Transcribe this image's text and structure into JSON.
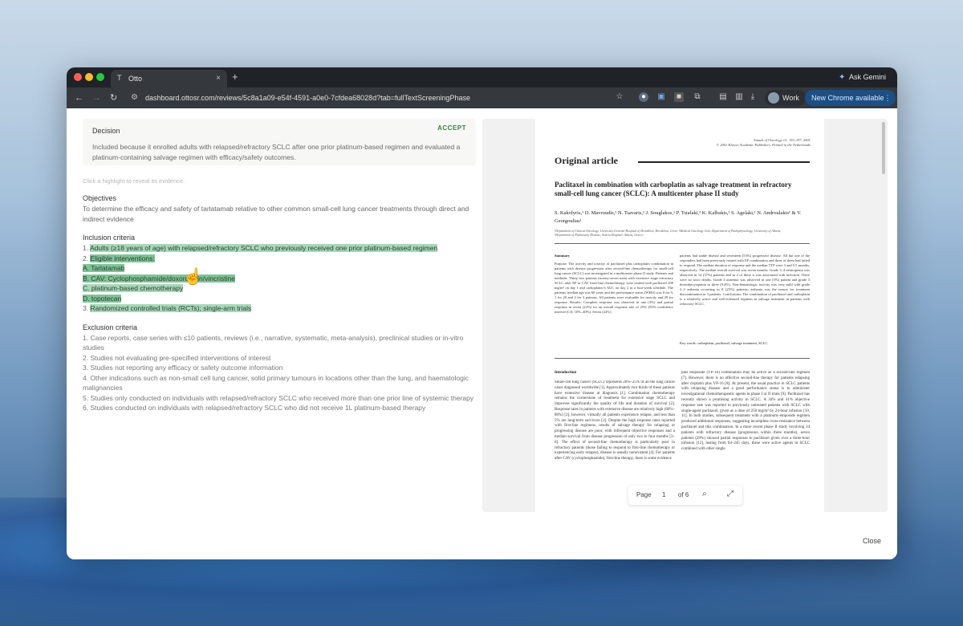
{
  "browser": {
    "tab_title": "Otto",
    "tab_favicon": "T",
    "tab_close": "×",
    "new_tab": "+",
    "ask_gemini": "Ask Gemini",
    "url": "dashboard.ottosr.com/reviews/5c8a1a09-e54f-4591-a0e0-7cfdea68028d?tab=fullTextScreeningPhase",
    "profile_label": "Work",
    "update_label": "New Chrome available"
  },
  "decision": {
    "title": "Decision",
    "status": "ACCEPT",
    "status_color": "#3b7d47",
    "text": "Included because it enrolled adults with relapsed/refractory SCLC after one prior platinum-based regimen and evaluated a platinum-containing salvage regimen with efficacy/safety outcomes."
  },
  "hint": "Click a highlight to reveal its evidence.",
  "objectives": {
    "title": "Objectives",
    "text": "To determine the efficacy and safety of tarlatamab relative to other common small-cell lung cancer treatments through direct and indirect evidence"
  },
  "inclusion": {
    "title": "Inclusion criteria",
    "items": [
      {
        "prefix": "1. ",
        "text": "Adults (≥18 years of age) with relapsed/refractory SCLC who previously received one prior platinum-based regimen"
      },
      {
        "prefix": "2. ",
        "text": "Eligible interventions:"
      },
      {
        "prefix": "",
        "text": "A. Tarlatamab"
      },
      {
        "prefix": "",
        "text": "B. CAV: Cyclophosphamide/doxorubicin/vincristine"
      },
      {
        "prefix": "",
        "text": "C. platinum-based chemotherapy"
      },
      {
        "prefix": "",
        "text": "D. topotecan"
      },
      {
        "prefix": "3. ",
        "text": "Randomized controlled trials (RCTs); single-arm trials"
      }
    ]
  },
  "exclusion": {
    "title": "Exclusion criteria",
    "items": [
      "1. Case reports, case series with ≤10 patients, reviews (i.e., narrative, systematic, meta-analysis), preclinical studies or in-vitro studies",
      "2. Studies not evaluating pre-specified interventions of interest",
      "3. Studies not reporting any efficacy or safety outcome information",
      "4.  Other indications such as non-small cell lung cancer, solid primary tumours in locations other than the lung, and haematologic malignancies",
      "5. Studies only conducted on individuals with relapsed/refractory SCLC who received more than one prior line of systemic therapy",
      "6. Studies conducted on individuals with relapsed/refractory SCLC who did not receive 1L platinum-based therapy"
    ]
  },
  "pdf": {
    "journal_line1": "Annals of Oncology 12: 193–197, 2001.",
    "journal_line2": "© 2001 Kluwer Academic Publishers. Printed in the Netherlands.",
    "article_type": "Original article",
    "title": "Paclitaxel in combination with carboplatin as salvage treatment in refractory small-cell lung cancer (SCLC): A multicenter phase II study",
    "authors": "S. Kakolyris,¹ D. Mavroudis,¹ N. Tsavaris,² J. Souglakos,¹ P. Tsiafaki,³ K. Kalbakis,¹ S. Agelaki,¹ N. Androulakis¹ & V. Georgoulias¹",
    "affiliations": "¹Department of Clinical Oncology, University General Hospital of Heraklion, Heraklion, Crete; ²Medical Oncology Unit, Department of Pathophysiology, University of Athens; ³Department of Pulmonary Disease, Sotiria Hospital, Athens, Greece",
    "summary_label": "Summary",
    "summary_left": "Purpose: The activity and toxicity of paclitaxel plus carboplatin combination in patients with disease progression after second-line chemotherapy for small-cell lung cancer (SCLC) was investigated in a multicenter phase II study. Patients and methods: Thirty-two patients (twenty-seven men) with extensive stage refractory SCLC after EP or CAV front-line chemotherapy were treated with paclitaxel 200 mg/m² on day 1 and carboplatin 6 AUC on day 2 in a four-week schedule. The patients' median age was 60 years and the performance status (WHO) was 0 for 9, 1 for 20 and 2 for 3 patients. All patients were evaluable for toxicity and 29 for response. Results: Complete response was observed in one (3%) and partial response in seven (22%) for an overall response rate of 25% (95% confidence interval (CI): 10%–40%). Seven (22%)",
    "summary_right": "patients had stable disease and seventeen (53%) progressive disease. All but one of the responders had been previously treated with EP combination and three of them had failed to respond. The median duration of response and the median TTP were 3 and 5.5 months, respectively. The median overall survival was seven months. Grade 3–4 neutropenia was observed in 12 (37%) patients and in 2 of these it was associated with infection. There were no toxic deaths. Grade 4 anaemia was observed in one (3%) patient and grade 3 thrombocytopenia in three (9.4%). Non-hematologic toxicity was very mild with grade 2–3 asthenia occurring in 8 (25%) patients; asthenia was the reason for treatment discontinuation in 3 patients. Conclusions: The combination of paclitaxel and carboplatin is a relatively active and well-tolerated regimen as salvage treatment in patients with refractory SCLC.",
    "keywords": "Key words: carboplatin, paclitaxel, salvage treatment, SCLC",
    "intro_label": "Introduction",
    "intro_left": "Small-cell lung cancer (SCLC) represents 20%–25% of all the lung cancer cases diagnosed worldwide [1]. Approximately two thirds of these patients have extensive disease at diagnosis [1]. Combination chemotherapy remains the cornerstone of treatment for extensive stage SCLC and improves significantly the quality of life and duration of survival [2]. Response rates in patients with extensive disease are relatively high (60%–80%) [2], however, virtually all patients experience relapse, and less than 5% are long-term survivors [2]. Despite the high response rates reported with first-line regimens, results of salvage therapy for relapsing or progressing disease are poor, with infrequent objective responses and a median survival from disease progression of only two to four months [3–6]. The effect of second-line chemotherapy is particularly poor in refractory patients (those failing to respond to first-line chemotherapy or experiencing early relapse), disease is usually nonexistent [4]. For patients after CAV (cyclophosphamide), first-line therapy, there is some evidence",
    "intro_right": "plus etoposide (VP-16) combination may be active as a second-line regimen [7]. However, there is no effective second-line therapy for patients relapsing after cisplatin plus VP-16 [8]. At present, the usual practice in SCLC patients with relapsing disease and a good performance status is to administer investigational chemotherapeutic agents in phase I or II trials [9]. Paclitaxel has recently shown a promising activity in SCLC. A 34% and 41% objective response rate was reported in previously untreated patients with SCLC with single-agent paclitaxel, given as a dose of 250 mg/m² by 24-hour infusion [10, 11]. In both studies, subsequent treatment with a platinum–etoposide regimen produced additional responses, suggesting incomplete cross-resistance between paclitaxel and this combination. In a more recent phase II study involving 24 patients with refractory disease (progression within three months), seven patients (29%) showed partial responses to paclitaxel given over a three-hour infusion [12], lasting from 64–245 days, these were active agents in SCLC combined with other single",
    "pager": {
      "label": "Page",
      "current": "1",
      "of": "of 6"
    }
  },
  "close_label": "Close",
  "icons": {
    "back": "←",
    "forward": "→",
    "reload": "↻",
    "star": "☆",
    "download": "⤓",
    "menu": "⋮",
    "search": "⌕",
    "expand": "⤢",
    "gemini": "✦",
    "cursor": "☝"
  }
}
